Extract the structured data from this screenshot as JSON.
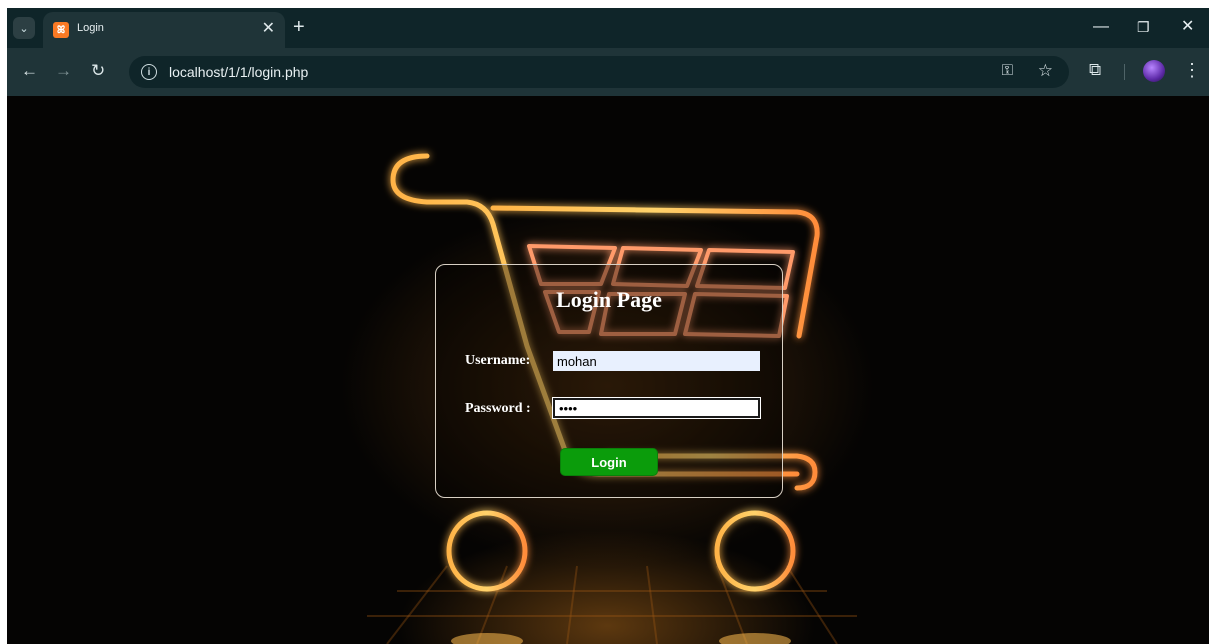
{
  "browser": {
    "tab": {
      "title": "Login",
      "favicon": "xampp-icon"
    },
    "address_bar": {
      "url": "localhost/1/1/login.php"
    }
  },
  "login": {
    "title": "Login Page",
    "username_label": "Username:",
    "username_value": "mohan",
    "password_label": "Password :",
    "password_value": "••••",
    "submit_label": "Login"
  },
  "colors": {
    "button_green": "#0b9c0b",
    "neon_orange": "#ff9a2e",
    "chrome_dark": "#0f2529"
  }
}
